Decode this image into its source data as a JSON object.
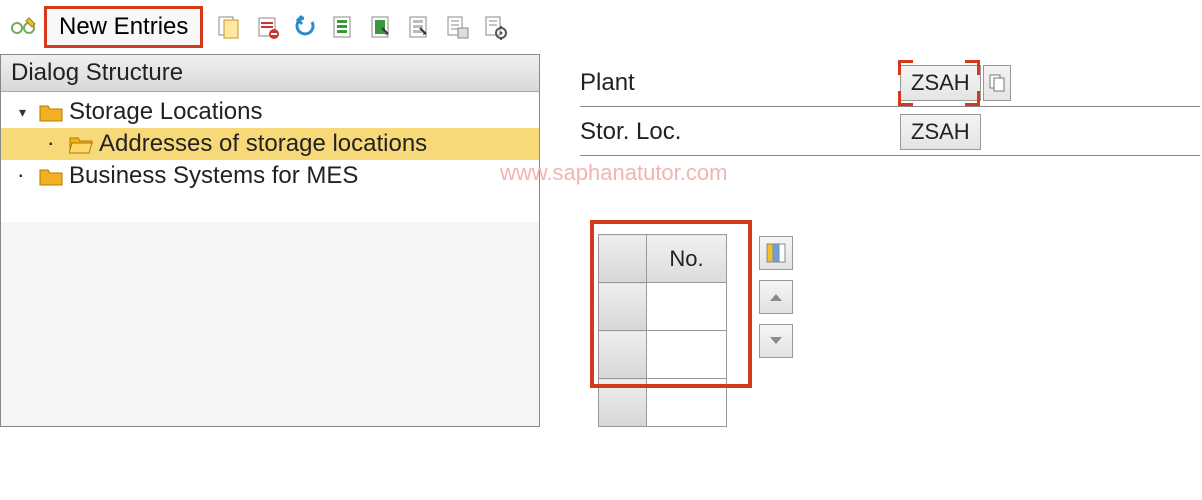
{
  "toolbar": {
    "new_entries_label": "New Entries"
  },
  "dialog_structure": {
    "title": "Dialog Structure",
    "nodes": [
      {
        "label": "Storage Locations",
        "expanded": true
      },
      {
        "label": "Addresses of storage locations",
        "selected": true
      },
      {
        "label": "Business Systems for MES"
      }
    ]
  },
  "form": {
    "plant_label": "Plant",
    "plant_value": "ZSAH",
    "storloc_label": "Stor. Loc.",
    "storloc_value": "ZSAH"
  },
  "watermark": "www.saphanatutor.com",
  "table": {
    "col_label": "No."
  }
}
